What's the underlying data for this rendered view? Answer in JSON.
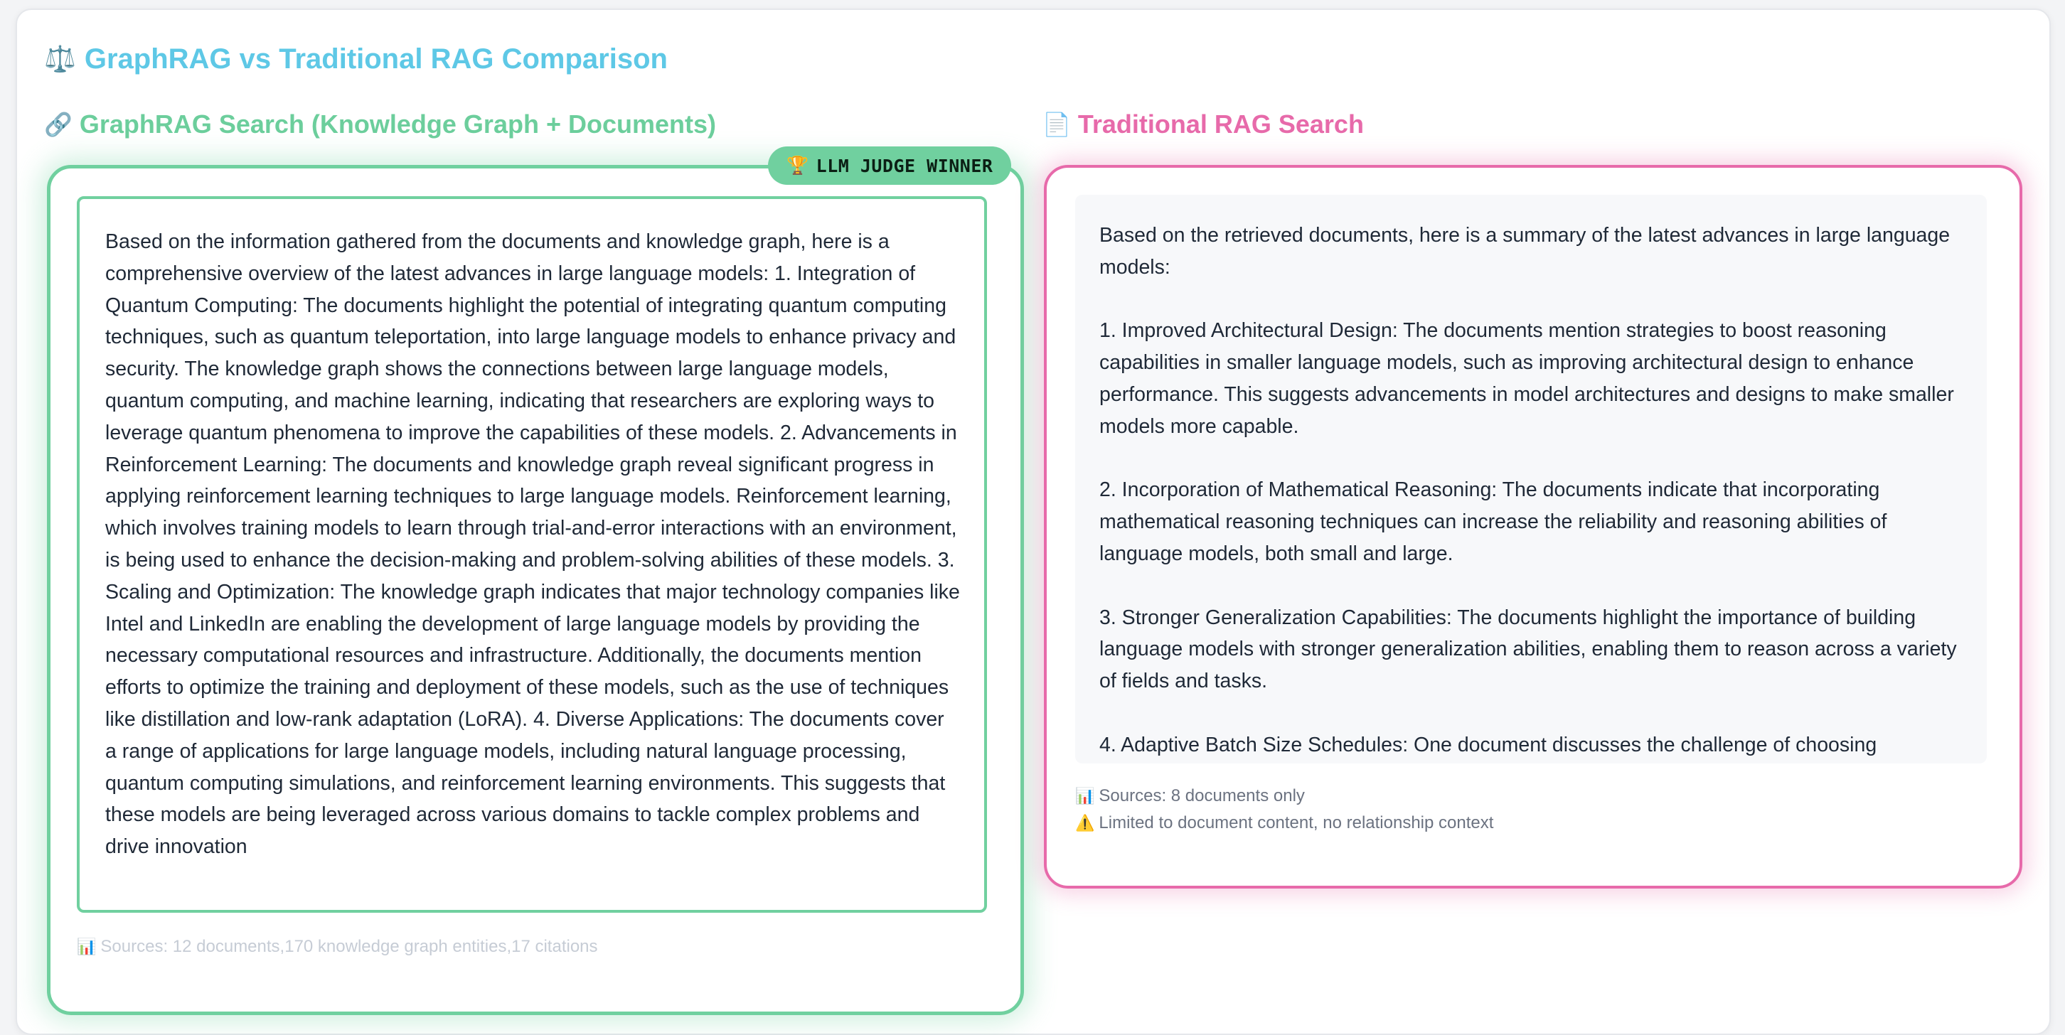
{
  "page": {
    "title": "GraphRAG vs Traditional RAG Comparison",
    "title_icon": "scale-icon",
    "title_glyph": "⚖️"
  },
  "graphrag": {
    "heading": "GraphRAG Search (Knowledge Graph + Documents)",
    "heading_icon": "link-icon",
    "heading_glyph": "🔗",
    "badge_glyph": "🏆",
    "badge_label": "LLM JUDGE WINNER",
    "answer": "Based on the information gathered from the documents and knowledge graph, here is a comprehensive overview of the latest advances in large language models: 1. Integration of Quantum Computing: The documents highlight the potential of integrating quantum computing techniques, such as quantum teleportation, into large language models to enhance privacy and security. The knowledge graph shows the connections between large language models, quantum computing, and machine learning, indicating that researchers are exploring ways to leverage quantum phenomena to improve the capabilities of these models. 2. Advancements in Reinforcement Learning: The documents and knowledge graph reveal significant progress in applying reinforcement learning techniques to large language models. Reinforcement learning, which involves training models to learn through trial-and-error interactions with an environment, is being used to enhance the decision-making and problem-solving abilities of these models. 3. Scaling and Optimization: The knowledge graph indicates that major technology companies like Intel and LinkedIn are enabling the development of large language models by providing the necessary computational resources and infrastructure. Additionally, the documents mention efforts to optimize the training and deployment of these models, such as the use of techniques like distillation and low-rank adaptation (LoRA). 4. Diverse Applications: The documents cover a range of applications for large language models, including natural language processing, quantum computing simulations, and reinforcement learning environments. This suggests that these models are being leveraged across various domains to tackle complex problems and drive innovation",
    "sources_glyph": "📊",
    "sources_text": "Sources: 12 documents,170 knowledge graph entities,17 citations"
  },
  "traditional": {
    "heading": "Traditional RAG Search",
    "heading_icon": "document-icon",
    "heading_glyph": "📄",
    "answer_paragraphs": [
      "Based on the retrieved documents, here is a summary of the latest advances in large language models:",
      "1. Improved Architectural Design: The documents mention strategies to boost reasoning capabilities in smaller language models, such as improving architectural design to enhance performance. This suggests advancements in model architectures and designs to make smaller models more capable.",
      "2. Incorporation of Mathematical Reasoning: The documents indicate that incorporating mathematical reasoning techniques can increase the reliability and reasoning abilities of language models, both small and large.",
      "3. Stronger Generalization Capabilities: The documents highlight the importance of building language models with stronger generalization abilities, enabling them to reason across a variety of fields and tasks.",
      "4. Adaptive Batch Size Schedules: One document discusses the challenge of choosing"
    ],
    "sources_glyph": "📊",
    "sources_text": "Sources: 8 documents only",
    "warning_glyph": "⚠️",
    "warning_text": "Limited to document content, no relationship context"
  },
  "colors": {
    "title": "#5ec8e6",
    "graphrag_accent": "#70d09f",
    "traditional_accent": "#e76aaa",
    "muted_text": "#6b7280"
  }
}
